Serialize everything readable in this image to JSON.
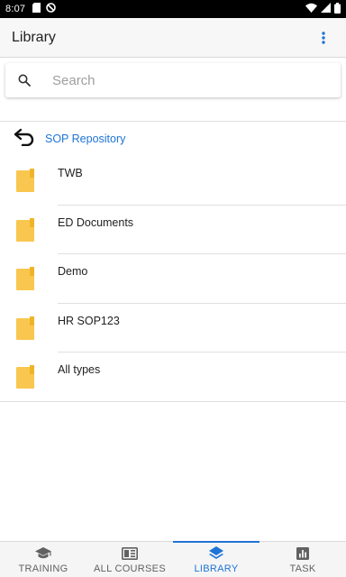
{
  "status_bar": {
    "time": "8:07",
    "left_icons": [
      "sd-card-icon",
      "do-not-disturb-icon"
    ],
    "right_icons": [
      "wifi-icon",
      "signal-icon",
      "battery-icon"
    ]
  },
  "app_bar": {
    "title": "Library",
    "menu_icon": "more-vertical-icon"
  },
  "search": {
    "placeholder": "Search",
    "value": ""
  },
  "breadcrumb": {
    "back_icon": "undo-arrow-icon",
    "label": "SOP Repository"
  },
  "folders": [
    {
      "name": "TWB"
    },
    {
      "name": "ED Documents"
    },
    {
      "name": "Demo"
    },
    {
      "name": "HR SOP123"
    },
    {
      "name": "All types"
    }
  ],
  "bottom_nav": {
    "tabs": [
      {
        "label": "TRAINING",
        "icon": "graduation-cap-icon",
        "active": false
      },
      {
        "label": "ALL COURSES",
        "icon": "book-icon",
        "active": false
      },
      {
        "label": "LIBRARY",
        "icon": "layers-icon",
        "active": true
      },
      {
        "label": "TASK",
        "icon": "bar-chart-icon",
        "active": false
      }
    ]
  },
  "colors": {
    "accent": "#1f74d6",
    "folder": "#f9c74f",
    "folder_tab": "#f0b429",
    "status_bar": "#000000",
    "app_bar": "#f7f7f7"
  }
}
